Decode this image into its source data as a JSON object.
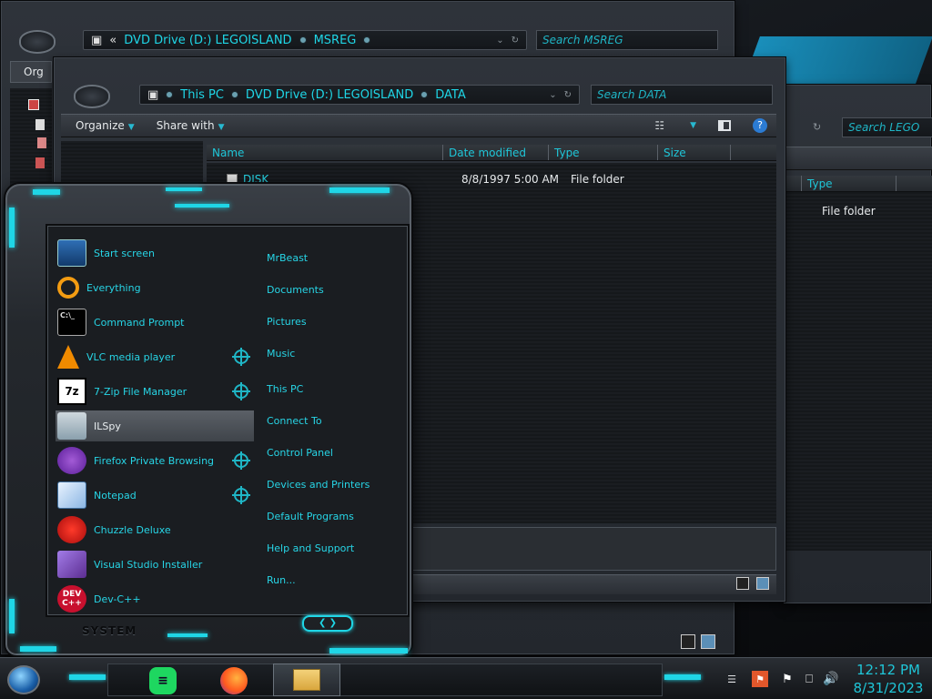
{
  "back_window": {
    "path": [
      "«",
      "DVD Drive (D:) LEGOISLAND",
      "MSREG"
    ],
    "search_placeholder": "Search MSREG",
    "left_toolbar_label": "Org"
  },
  "right_window": {
    "search_placeholder": "Search LEGO",
    "column_type": "Type",
    "item_type": "File folder"
  },
  "main_window": {
    "path": [
      "This PC",
      "DVD Drive (D:) LEGOISLAND",
      "DATA"
    ],
    "search_placeholder": "Search DATA",
    "toolbar": {
      "organize": "Organize",
      "share_with": "Share with"
    },
    "columns": [
      "Name",
      "Date modified",
      "Type",
      "Size"
    ],
    "files": [
      {
        "name": "DISK",
        "date": "8/8/1997 5:00 AM",
        "type": "File folder",
        "size": ""
      }
    ]
  },
  "start_menu": {
    "programs": [
      {
        "label": "Start screen",
        "icon": "start-screen-icon",
        "jump": false
      },
      {
        "label": "Everything",
        "icon": "everything-search-icon",
        "jump": false
      },
      {
        "label": "Command Prompt",
        "icon": "command-prompt-icon",
        "jump": false
      },
      {
        "label": "VLC media player",
        "icon": "vlc-icon",
        "jump": true
      },
      {
        "label": "7-Zip File Manager",
        "icon": "7zip-icon",
        "jump": true
      },
      {
        "label": "ILSpy",
        "icon": "ilspy-icon",
        "jump": false,
        "highlighted": true
      },
      {
        "label": "Firefox Private Browsing",
        "icon": "firefox-private-icon",
        "jump": true
      },
      {
        "label": "Notepad",
        "icon": "notepad-icon",
        "jump": true
      },
      {
        "label": "Chuzzle Deluxe",
        "icon": "chuzzle-icon",
        "jump": false
      },
      {
        "label": "Visual Studio Installer",
        "icon": "visual-studio-installer-icon",
        "jump": false
      },
      {
        "label": "Dev-C++",
        "icon": "devcpp-icon",
        "jump": false
      }
    ],
    "icon_text": {
      "7zip": "7z",
      "devcpp": "DEV C++",
      "cmd": "C:\\_"
    },
    "places": [
      "MrBeast",
      "Documents",
      "Pictures",
      "Music",
      "This PC",
      "Connect To",
      "Control Panel",
      "Devices and Printers",
      "Default Programs",
      "Help and Support",
      "Run..."
    ],
    "system_label": "SYSTEM"
  },
  "taskbar": {
    "time": "12:12 PM",
    "date": "8/31/2023",
    "pinned": [
      "spotify-icon",
      "firefox-icon",
      "file-explorer-icon"
    ],
    "tray": [
      "action-center-icon",
      "flag-icon",
      "network-icon",
      "volume-icon"
    ]
  },
  "colors": {
    "accent": "#1fd6e6",
    "window": "#2a2e34",
    "dark": "#15181b"
  }
}
